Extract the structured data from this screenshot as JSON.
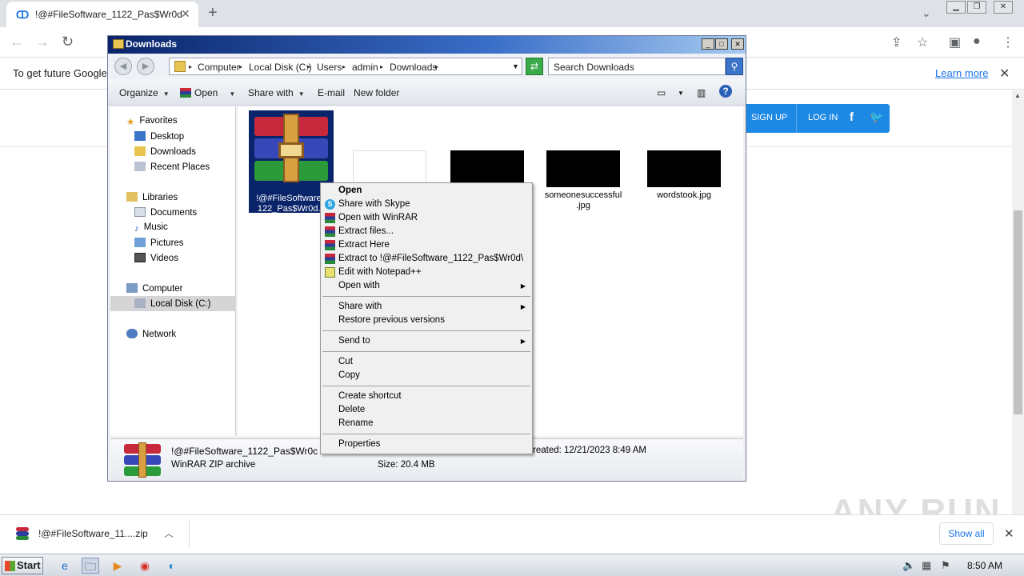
{
  "browser": {
    "tab_title": "!@#FileSoftware_1122_Pas$Wr0d",
    "infobar_message": "To get future Google",
    "infobar_learn_more": "Learn more",
    "download_item": "!@#FileSoftware_11....zip",
    "show_all": "Show all"
  },
  "webpage": {
    "sign_up": "SIGN UP",
    "log_in": "LOG IN",
    "watermark": "ANY RUN"
  },
  "explorer": {
    "title": "Downloads",
    "breadcrumb": [
      "Computer",
      "Local Disk (C:)",
      "Users",
      "admin",
      "Downloads"
    ],
    "search_placeholder": "Search Downloads",
    "commands": {
      "organize": "Organize",
      "open": "Open",
      "share_with": "Share with",
      "email": "E-mail",
      "new_folder": "New folder"
    },
    "nav": {
      "favorites": "Favorites",
      "desktop": "Desktop",
      "downloads": "Downloads",
      "recent_places": "Recent Places",
      "libraries": "Libraries",
      "documents": "Documents",
      "music": "Music",
      "pictures": "Pictures",
      "videos": "Videos",
      "computer": "Computer",
      "local_disk": "Local Disk (C:)",
      "network": "Network"
    },
    "files": {
      "selected_line1": "!@#FileSoftware_",
      "selected_line2": "122_Pas$Wr0d.z",
      "someone_line1": "someonesuccessful",
      "someone_line2": ".jpg",
      "wordstook": "wordstook.jpg"
    },
    "details": {
      "name": "!@#FileSoftware_1122_Pas$Wr0c",
      "type": "WinRAR ZIP archive",
      "created": "reated: 12/21/2023 8:49 AM",
      "size": "Size: 20.4 MB"
    }
  },
  "context_menu": {
    "open": "Open",
    "share_skype": "Share with Skype",
    "open_winrar": "Open with WinRAR",
    "extract_files": "Extract files...",
    "extract_here": "Extract Here",
    "extract_to": "Extract to !@#FileSoftware_1122_Pas$Wr0d\\",
    "edit_notepad": "Edit with Notepad++",
    "open_with": "Open with",
    "share_with": "Share with",
    "restore": "Restore previous versions",
    "send_to": "Send to",
    "cut": "Cut",
    "copy": "Copy",
    "create_shortcut": "Create shortcut",
    "delete": "Delete",
    "rename": "Rename",
    "properties": "Properties"
  },
  "taskbar": {
    "start": "Start",
    "clock": "8:50 AM"
  },
  "colors": {
    "accent": "#1e88e5",
    "title_bar": "#0a246a",
    "selection": "#0a246a"
  }
}
